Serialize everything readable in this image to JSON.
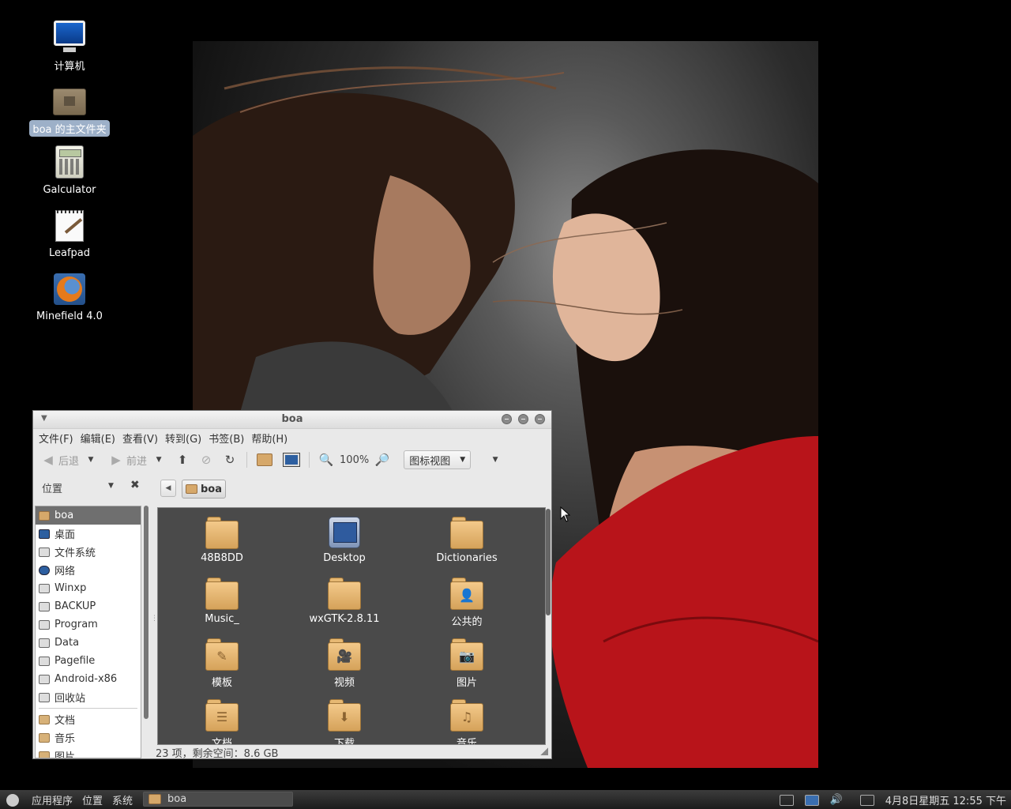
{
  "desktop": {
    "icons": [
      {
        "label": "计算机",
        "icon": "computer-icon"
      },
      {
        "label": "boa 的主文件夹",
        "icon": "home-folder-icon"
      },
      {
        "label": "Galculator",
        "icon": "calculator-icon"
      },
      {
        "label": "Leafpad",
        "icon": "text-editor-icon"
      },
      {
        "label": "Minefield 4.0",
        "icon": "firefox-icon"
      }
    ]
  },
  "window": {
    "title": "boa",
    "menu": [
      "文件(F)",
      "编辑(E)",
      "查看(V)",
      "转到(G)",
      "书签(B)",
      "帮助(H)"
    ],
    "toolbar": {
      "back": "后退",
      "forward": "前进",
      "zoom": "100%",
      "view_mode": "图标视图"
    },
    "side_pane_selector": "位置",
    "breadcrumb": "boa",
    "sidebar_items": [
      {
        "label": "boa",
        "icon": "home"
      },
      {
        "label": "桌面",
        "icon": "desk"
      },
      {
        "label": "文件系统",
        "icon": "drive"
      },
      {
        "label": "网络",
        "icon": "net"
      },
      {
        "label": "Winxp",
        "icon": "drive"
      },
      {
        "label": "BACKUP",
        "icon": "drive"
      },
      {
        "label": "Program",
        "icon": "drive"
      },
      {
        "label": "Data",
        "icon": "drive"
      },
      {
        "label": "Pagefile",
        "icon": "drive"
      },
      {
        "label": "Android-x86",
        "icon": "drive"
      },
      {
        "label": "回收站",
        "icon": "drive"
      },
      {
        "label": "文档",
        "icon": "folder"
      },
      {
        "label": "音乐",
        "icon": "folder"
      },
      {
        "label": "图片",
        "icon": "folder"
      }
    ],
    "files": [
      {
        "name": "48B8DD",
        "emblem": ""
      },
      {
        "name": "Desktop",
        "emblem": "desktop"
      },
      {
        "name": "Dictionaries",
        "emblem": ""
      },
      {
        "name": "Music_",
        "emblem": ""
      },
      {
        "name": "wxGTK-2.8.11",
        "emblem": ""
      },
      {
        "name": "公共的",
        "emblem": "👤"
      },
      {
        "name": "模板",
        "emblem": "✎"
      },
      {
        "name": "视频",
        "emblem": "🎥"
      },
      {
        "name": "图片",
        "emblem": "📷"
      },
      {
        "name": "文档",
        "emblem": "☰"
      },
      {
        "name": "下载",
        "emblem": "⬇"
      },
      {
        "name": "音乐",
        "emblem": "♫"
      }
    ],
    "status": "23 项，剩余空间：8.6 GB"
  },
  "panel": {
    "menus": [
      "应用程序",
      "位置",
      "系统"
    ],
    "task": "boa",
    "clock": "4月8日星期五 12:55 下午"
  }
}
